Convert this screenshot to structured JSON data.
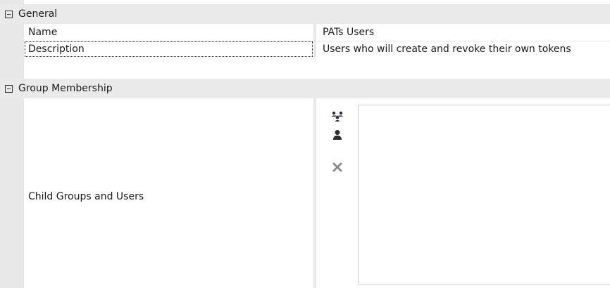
{
  "sections": {
    "general": {
      "title": "General",
      "expanded": true
    },
    "group_membership": {
      "title": "Group Membership",
      "expanded": true
    }
  },
  "properties": {
    "name": {
      "label": "Name",
      "value": "PATs Users"
    },
    "description": {
      "label": "Description",
      "value": "Users who will create and revoke their own tokens"
    }
  },
  "membership": {
    "label": "Child Groups and Users",
    "tools": [
      {
        "icon": "add-group-icon"
      },
      {
        "icon": "add-user-icon"
      },
      {
        "icon": "remove-icon"
      }
    ],
    "items": []
  }
}
